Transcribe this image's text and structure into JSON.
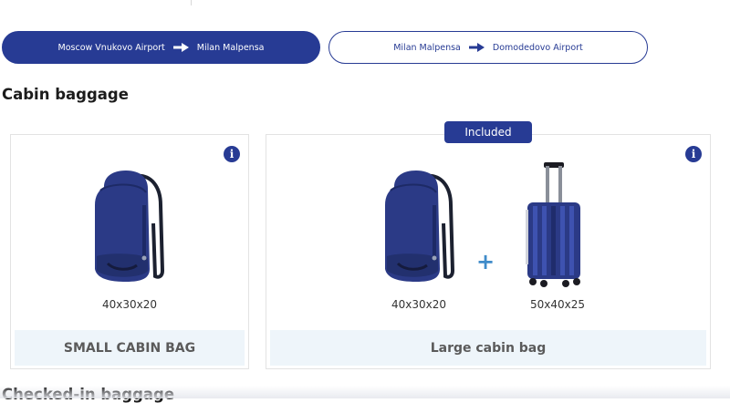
{
  "routes": [
    {
      "from": "Moscow Vnukovo Airport",
      "to": "Milan Malpensa",
      "active": true,
      "arrow_icon": "arrow-right-icon"
    },
    {
      "from": "Milan Malpensa",
      "to": "Domodedovo Airport",
      "active": false,
      "arrow_icon": "arrow-right-icon"
    }
  ],
  "sections": {
    "cabin_title": "Cabin baggage",
    "checked_title": "Checked-in baggage"
  },
  "cabin_options": [
    {
      "name": "SMALL CABIN BAG",
      "info_icon": "info-icon",
      "items": [
        {
          "icon": "backpack-icon",
          "dimensions": "40x30x20"
        }
      ]
    },
    {
      "name": "Large cabin bag",
      "badge": "Included",
      "info_icon": "info-icon",
      "plus": "+",
      "items": [
        {
          "icon": "backpack-icon",
          "dimensions": "40x30x20"
        },
        {
          "icon": "trolley-suitcase-icon",
          "dimensions": "50x40x25"
        }
      ]
    }
  ],
  "info_glyph": "i",
  "colors": {
    "brand": "#273b94",
    "name_bar_bg": "#eef5fa",
    "plus": "#3f8bc9",
    "bag_blue": "#2b3a86"
  }
}
